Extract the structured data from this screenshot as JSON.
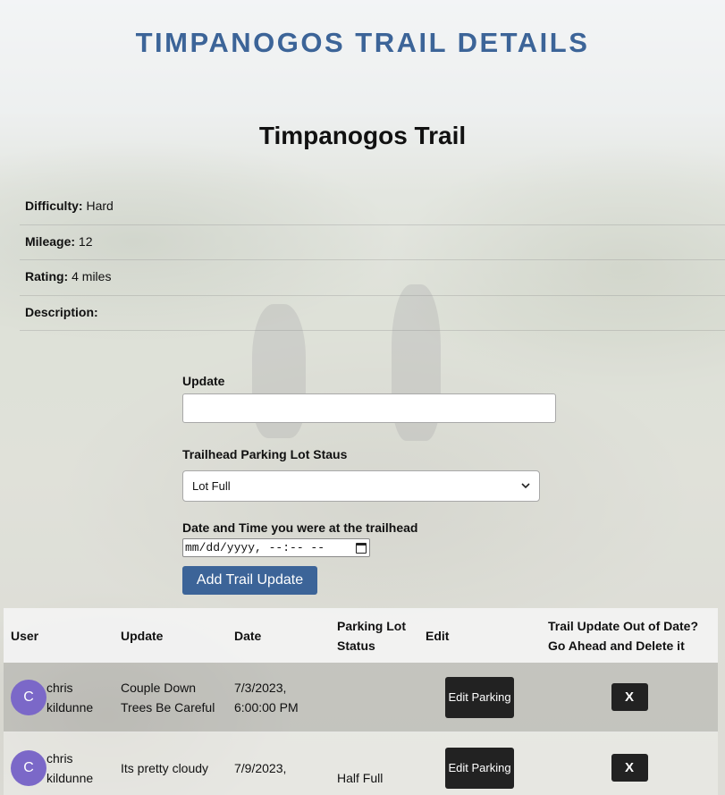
{
  "header": {
    "site_title": "TIMPANOGOS TRAIL DETAILS"
  },
  "trail": {
    "name": "Timpanogos Trail",
    "difficulty_label": "Difficulty:",
    "difficulty": "Hard",
    "mileage_label": "Mileage:",
    "mileage": "12",
    "rating_label": "Rating:",
    "rating": "4 miles",
    "description_label": "Description:",
    "description": ""
  },
  "form": {
    "update_label": "Update",
    "update_value": "",
    "parking_label": "Trailhead Parking Lot Staus",
    "parking_selected": "Lot Full",
    "date_label": "Date and Time you were at the trailhead",
    "date_placeholder": "mm/dd/yyyy, --:-- --",
    "submit_label": "Add Trail Update"
  },
  "table": {
    "headers": {
      "user": "User",
      "update": "Update",
      "date": "Date",
      "parking": "Parking Lot Status",
      "edit": "Edit",
      "delete": "Trail Update Out of Date? Go Ahead and Delete it"
    },
    "rows": [
      {
        "avatar_letter": "C",
        "user": "chris kildunne",
        "update": "Couple Down Trees Be Careful",
        "date": "7/3/2023, 6:00:00 PM",
        "parking": "",
        "edit_label": "Edit Parking",
        "delete_label": "X"
      },
      {
        "avatar_letter": "C",
        "user": "chris kildunne",
        "update": "Its pretty cloudy",
        "date": "7/9/2023,",
        "parking": "Half Full",
        "edit_label": "Edit Parking",
        "delete_label": "X"
      }
    ]
  },
  "colors": {
    "title_blue": "#3c6498",
    "button_dark": "#222222",
    "avatar_purple": "#7b68c8"
  }
}
